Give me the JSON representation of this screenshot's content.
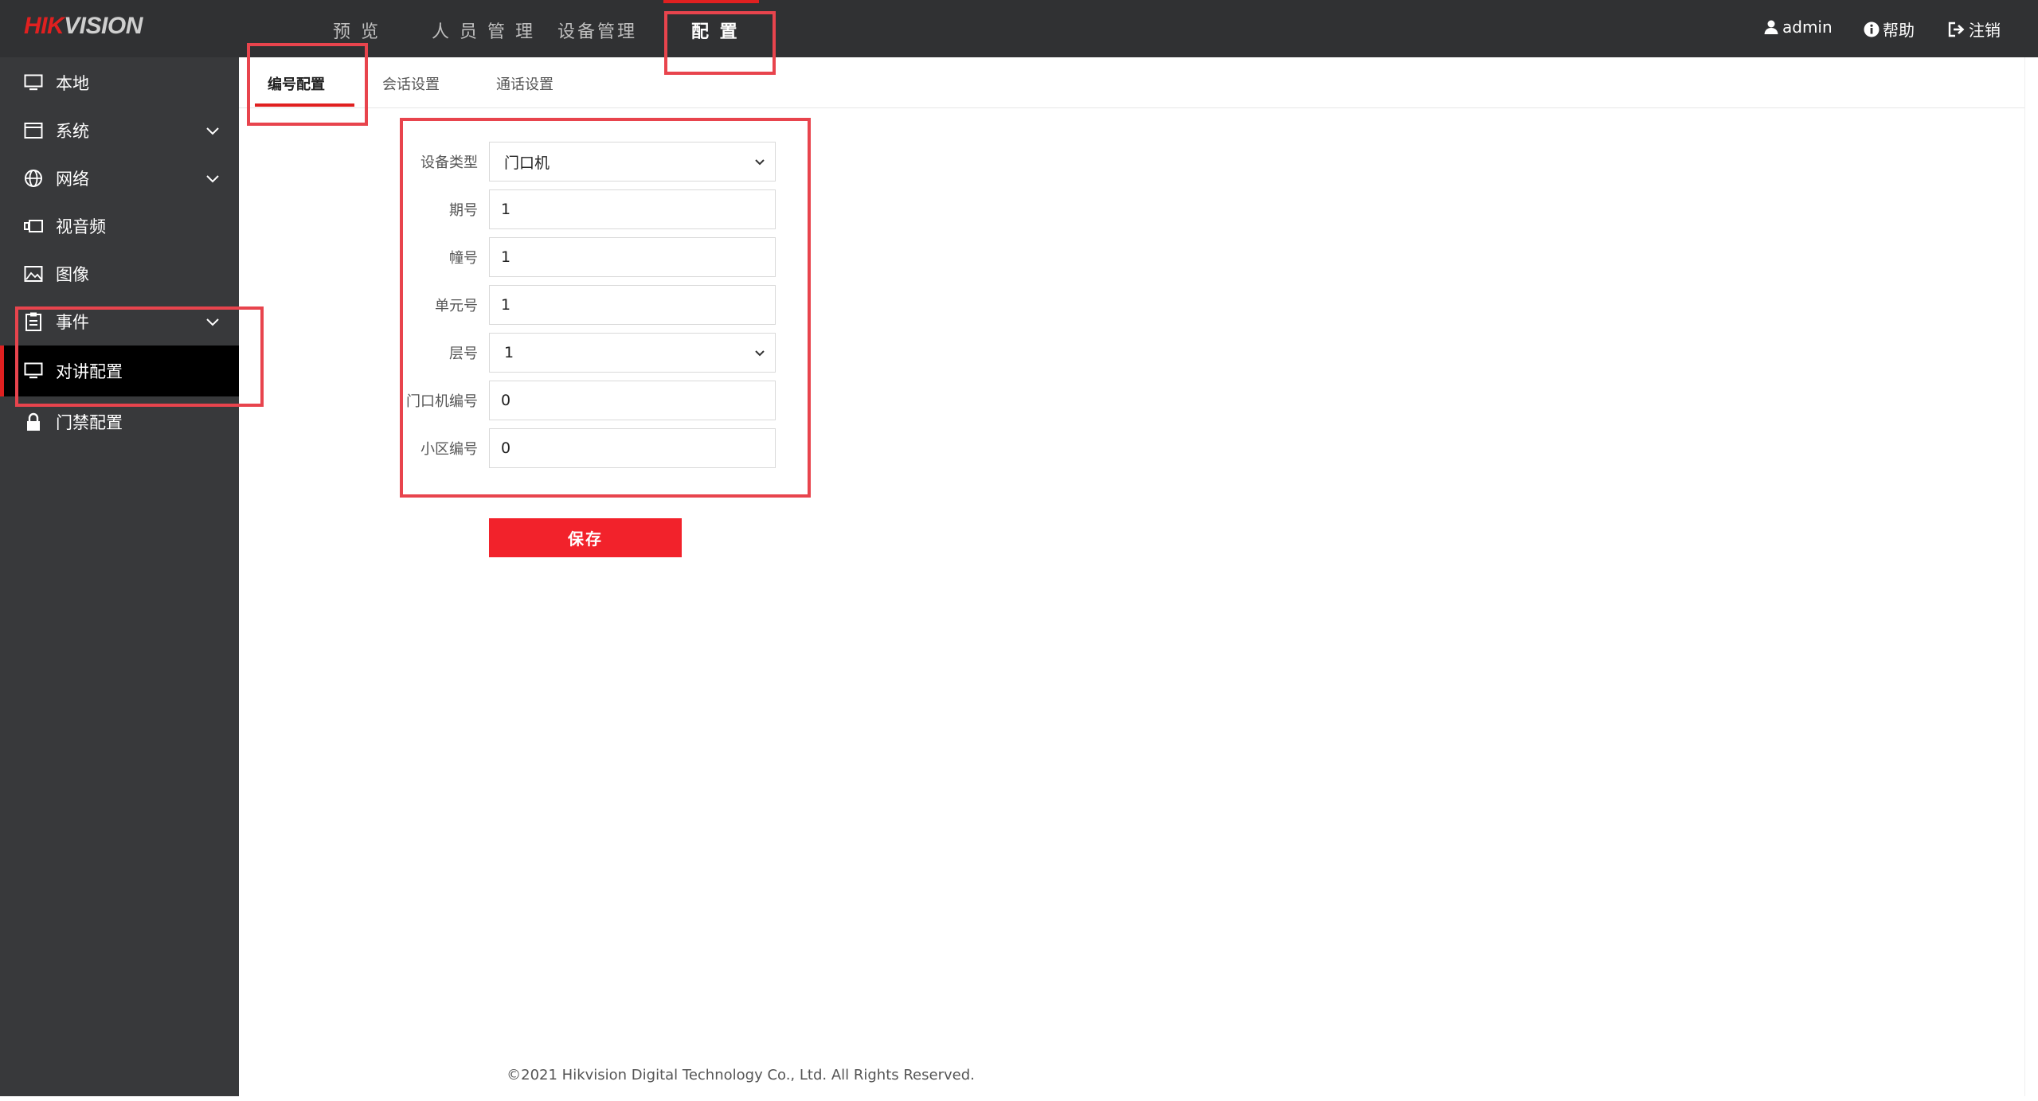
{
  "brand": {
    "logo_red": "HIK",
    "logo_rest": "VISION",
    "accent_color": "#e02020"
  },
  "topnav": {
    "items": [
      {
        "label": "预 览"
      },
      {
        "label": "人 员 管 理"
      },
      {
        "label": "设备管理"
      },
      {
        "label": "配 置",
        "active": true
      }
    ]
  },
  "topright": {
    "user": "admin",
    "help": "帮助",
    "logout": "注销",
    "icons": [
      "user-icon",
      "info-icon",
      "logout-icon"
    ]
  },
  "sidebar": {
    "items": [
      {
        "label": "本地",
        "icon": "monitor-icon"
      },
      {
        "label": "系统",
        "icon": "window-icon",
        "expandable": true
      },
      {
        "label": "网络",
        "icon": "globe-icon",
        "expandable": true
      },
      {
        "label": "视音频",
        "icon": "camera-icon"
      },
      {
        "label": "图像",
        "icon": "image-icon"
      },
      {
        "label": "事件",
        "icon": "clipboard-icon",
        "expandable": true
      },
      {
        "label": "对讲配置",
        "icon": "monitor-icon",
        "active": true
      },
      {
        "label": "门禁配置",
        "icon": "lock-icon"
      }
    ]
  },
  "subtabs": {
    "items": [
      {
        "label": "编号配置",
        "active": true
      },
      {
        "label": "会话设置"
      },
      {
        "label": "通话设置"
      }
    ]
  },
  "form": {
    "device_type": {
      "label": "设备类型",
      "value": "门口机"
    },
    "period_no": {
      "label": "期号",
      "value": "1"
    },
    "building_no": {
      "label": "幢号",
      "value": "1"
    },
    "unit_no": {
      "label": "单元号",
      "value": "1"
    },
    "floor_no": {
      "label": "层号",
      "value": "1"
    },
    "door_station_no": {
      "label": "门口机编号",
      "value": "0"
    },
    "community_no": {
      "label": "小区编号",
      "value": "0"
    }
  },
  "actions": {
    "save_label": "保存"
  },
  "footer": {
    "copyright": "©2021 Hikvision Digital Technology Co., Ltd. All Rights Reserved."
  }
}
